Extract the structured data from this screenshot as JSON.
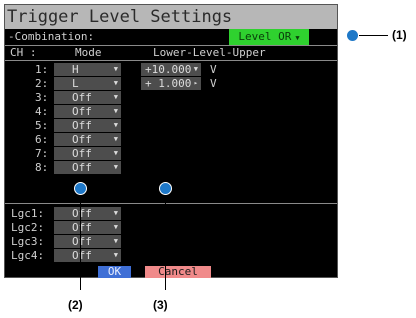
{
  "title": "Trigger Level Settings",
  "combination": {
    "label": "-Combination:",
    "value": "Level OR"
  },
  "headers": {
    "ch": "CH :",
    "mode": "Mode",
    "level": "Lower-Level-Upper"
  },
  "channels": [
    {
      "label": "1:",
      "mode": "H",
      "value1": "+10.000",
      "unit": "V"
    },
    {
      "label": "2:",
      "mode": "L",
      "value1": "+ 1.000",
      "unit": "V"
    },
    {
      "label": "3:",
      "mode": "Off"
    },
    {
      "label": "4:",
      "mode": "Off"
    },
    {
      "label": "5:",
      "mode": "Off"
    },
    {
      "label": "6:",
      "mode": "Off"
    },
    {
      "label": "7:",
      "mode": "Off"
    },
    {
      "label": "8:",
      "mode": "Off"
    }
  ],
  "logic": [
    {
      "label": "Lgc1:",
      "mode": "Off"
    },
    {
      "label": "Lgc2:",
      "mode": "Off"
    },
    {
      "label": "Lgc3:",
      "mode": "Off"
    },
    {
      "label": "Lgc4:",
      "mode": "Off"
    }
  ],
  "buttons": {
    "ok": "OK",
    "cancel": "Cancel"
  },
  "callouts": {
    "c1": "(1)",
    "c2": "(2)",
    "c3": "(3)"
  },
  "colors": {
    "combo_bg": "#2fd12f",
    "ok_bg": "#3f6fd6",
    "cancel_bg": "#f08a8a",
    "marker": "#1e78c8"
  },
  "icons": {
    "dropdown": "triangle-down-icon"
  }
}
